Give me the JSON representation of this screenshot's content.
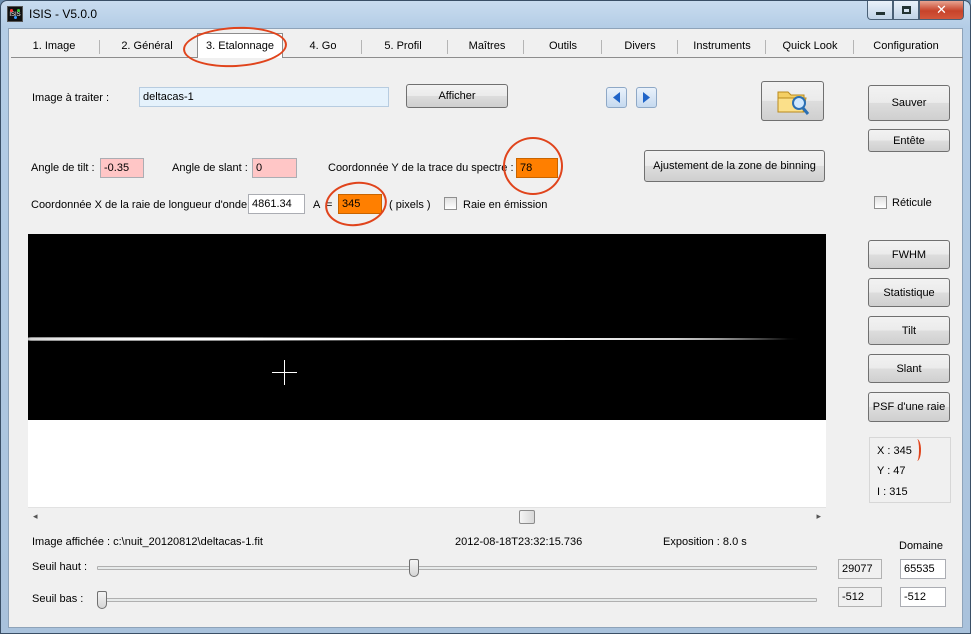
{
  "window": {
    "title": "ISIS - V5.0.0",
    "icon_label": "ISIS"
  },
  "tabs": [
    {
      "label": "1. Image",
      "selected": false
    },
    {
      "label": "2. Général",
      "selected": false
    },
    {
      "label": "3. Etalonnage",
      "selected": true
    },
    {
      "label": "4. Go",
      "selected": false
    },
    {
      "label": "5. Profil",
      "selected": false
    },
    {
      "label": "Maîtres",
      "selected": false
    },
    {
      "label": "Outils",
      "selected": false
    },
    {
      "label": "Divers",
      "selected": false
    },
    {
      "label": "Instruments",
      "selected": false
    },
    {
      "label": "Quick Look",
      "selected": false
    },
    {
      "label": "Configuration",
      "selected": false
    }
  ],
  "image_row": {
    "label": "Image à traiter :",
    "value": "deltacas-1",
    "show_button": "Afficher"
  },
  "angles": {
    "tilt_label": "Angle de tilt :",
    "tilt_value": "-0.35",
    "slant_label": "Angle de slant :",
    "slant_value": "0",
    "trace_y_label": "Coordonnée Y de la trace du spectre :",
    "trace_y_value": "78"
  },
  "binning_button": "Ajustement de la zone de binning",
  "wavelength": {
    "label": "Coordonnée X de la raie de longueur d'onde",
    "value": "4861.34",
    "unit": "A",
    "equals": "=",
    "pixel_value": "345",
    "pixels_label": "( pixels )",
    "emission_label": "Raie en émission",
    "emission_checked": false
  },
  "right_panel": {
    "save": "Sauver",
    "header": "Entête",
    "reticle_label": "Réticule",
    "reticle_checked": false,
    "fwhm": "FWHM",
    "stats": "Statistique",
    "tilt": "Tilt",
    "slant": "Slant",
    "psf": "PSF d'une raie"
  },
  "cursor": {
    "x": "X : 345",
    "y": "Y : 47",
    "i": "I : 315"
  },
  "status": {
    "image_label": "Image affichée : c:\\nuit_20120812\\deltacas-1.fit",
    "datetime": "2012-08-18T23:32:15.736",
    "exposure": "Exposition : 8.0 s"
  },
  "thresholds": {
    "high_label": "Seuil haut :",
    "low_label": "Seuil bas :",
    "domain_label": "Domaine",
    "high_value": "29077",
    "high_domain": "65535",
    "low_value": "-512",
    "low_domain": "-512",
    "high_slider_fraction": 0.44,
    "low_slider_fraction": 0.0
  },
  "colors": {
    "required_field": "#ffc6c6",
    "highlight_field": "#ff7f00",
    "annotation": "#e0441c"
  }
}
